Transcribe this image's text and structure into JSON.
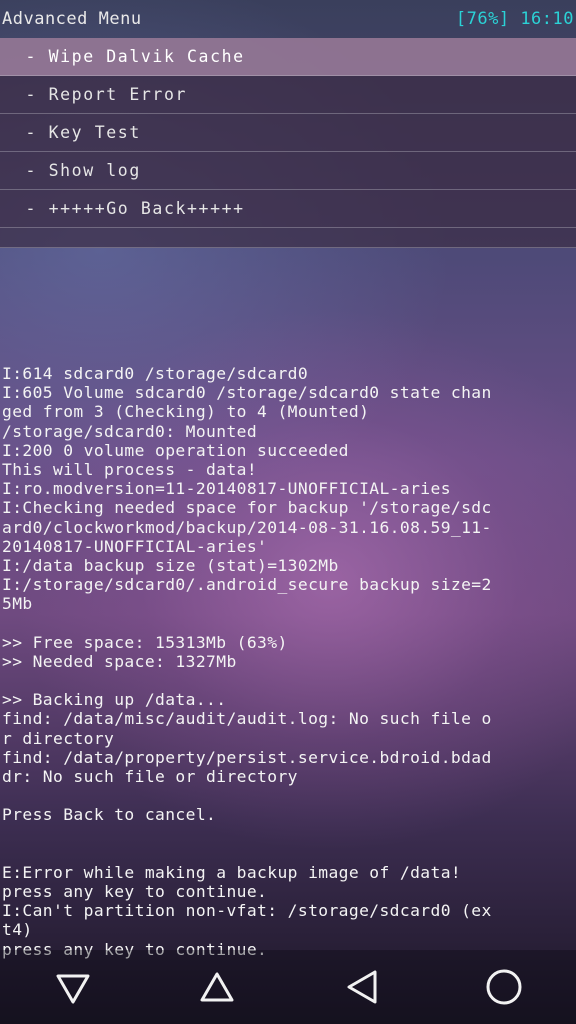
{
  "status": {
    "title": "Advanced Menu",
    "battery": "[76%]",
    "time": "16:10"
  },
  "menu": {
    "items": [
      {
        "label": " - Wipe Dalvik Cache",
        "selected": true
      },
      {
        "label": " - Report Error",
        "selected": false
      },
      {
        "label": " - Key Test",
        "selected": false
      },
      {
        "label": " - Show log",
        "selected": false
      },
      {
        "label": " - +++++Go Back+++++",
        "selected": false
      }
    ]
  },
  "log": {
    "lines": [
      "I:614 sdcard0 /storage/sdcard0",
      "I:605 Volume sdcard0 /storage/sdcard0 state chan",
      "ged from 3 (Checking) to 4 (Mounted)",
      "/storage/sdcard0: Mounted",
      "I:200 0 volume operation succeeded",
      "This will process - data!",
      "I:ro.modversion=11-20140817-UNOFFICIAL-aries",
      "I:Checking needed space for backup '/storage/sdc",
      "ard0/clockworkmod/backup/2014-08-31.16.08.59_11-",
      "20140817-UNOFFICIAL-aries'",
      "I:/data backup size (stat)=1302Mb",
      "I:/storage/sdcard0/.android_secure backup size=2",
      "5Mb",
      "",
      ">> Free space: 15313Mb (63%)",
      ">> Needed space: 1327Mb",
      "",
      ">> Backing up /data...",
      "find: /data/misc/audit/audit.log: No such file o",
      "r directory",
      "find: /data/property/persist.service.bdroid.bdad",
      "dr: No such file or directory",
      "",
      "Press Back to cancel.",
      "",
      "",
      "E:Error while making a backup image of /data!",
      "press any key to continue.",
      "I:Can't partition non-vfat: /storage/sdcard0 (ex",
      "t4)",
      "press any key to continue."
    ]
  },
  "nav": {
    "icons": [
      "back-triangle-down-icon",
      "home-triangle-up-icon",
      "back-icon",
      "circle-icon"
    ]
  },
  "colors": {
    "status_accent": "#2bd2d6",
    "selected_bg": "#967896"
  }
}
